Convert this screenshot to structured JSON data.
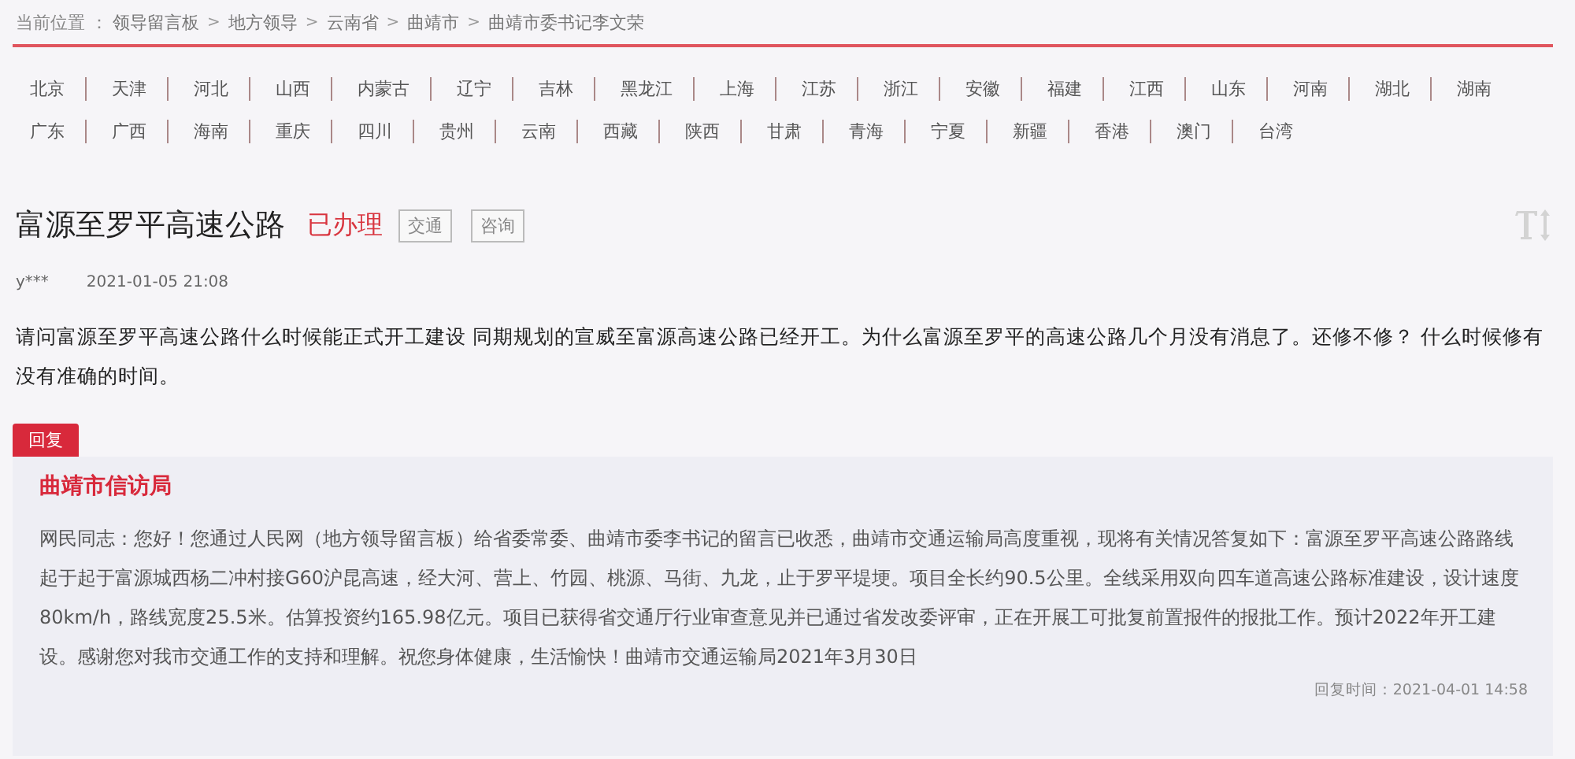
{
  "breadcrumb": {
    "label": "当前位置 ：",
    "items": [
      {
        "text": "领导留言板",
        "kind": "link"
      },
      {
        "text": ">",
        "kind": "separator"
      },
      {
        "text": "地方领导",
        "kind": "link"
      },
      {
        "text": ">",
        "kind": "separator"
      },
      {
        "text": "云南省",
        "kind": "link"
      },
      {
        "text": ">",
        "kind": "separator"
      },
      {
        "text": "曲靖市",
        "kind": "link"
      },
      {
        "text": ">",
        "kind": "separator"
      },
      {
        "text": "曲靖市委书记李文荣",
        "kind": "link"
      }
    ]
  },
  "regions": [
    [
      "北京",
      "天津",
      "河北",
      "山西",
      "内蒙古",
      "辽宁",
      "吉林",
      "黑龙江",
      "上海",
      "江苏",
      "浙江",
      "安徽",
      "福建",
      "江西",
      "山东",
      "河南",
      "湖北",
      "湖南"
    ],
    [
      "广东",
      "广西",
      "海南",
      "重庆",
      "四川",
      "贵州",
      "云南",
      "西藏",
      "陕西",
      "甘肃",
      "青海",
      "宁夏",
      "新疆",
      "香港",
      "澳门",
      "台湾"
    ]
  ],
  "message": {
    "title": "富源至罗平高速公路",
    "status": "已办理",
    "tags": [
      "交通",
      "咨询"
    ],
    "author": "y***",
    "time": "2021-01-05 21:08",
    "body": "请问富源至罗平高速公路什么时候能正式开工建设 同期规划的宣威至富源高速公路已经开工。为什么富源至罗平的高速公路几个月没有消息了。还修不修？ 什么时候修有没有准确的时间。"
  },
  "reply": {
    "tab": "回复",
    "org": "曲靖市信访局",
    "body": "网民同志：您好！您通过人民网（地方领导留言板）给省委常委、曲靖市委李书记的留言已收悉，曲靖市交通运输局高度重视，现将有关情况答复如下：富源至罗平高速公路路线起于起于富源城西杨二冲村接G60沪昆高速，经大河、营上、竹园、桃源、马街、九龙，止于罗平堤埂。项目全长约90.5公里。全线采用双向四车道高速公路标准建设，设计速度80km/h，路线宽度25.5米。估算投资约165.98亿元。项目已获得省交通厅行业审查意见并已通过省发改委评审，正在开展工可批复前置报件的报批工作。预计2022年开工建设。感谢您对我市交通工作的支持和理解。祝您身体健康，生活愉快！曲靖市交通运输局2021年3月30日",
    "time": "回复时间：2021-04-01 14:58"
  }
}
